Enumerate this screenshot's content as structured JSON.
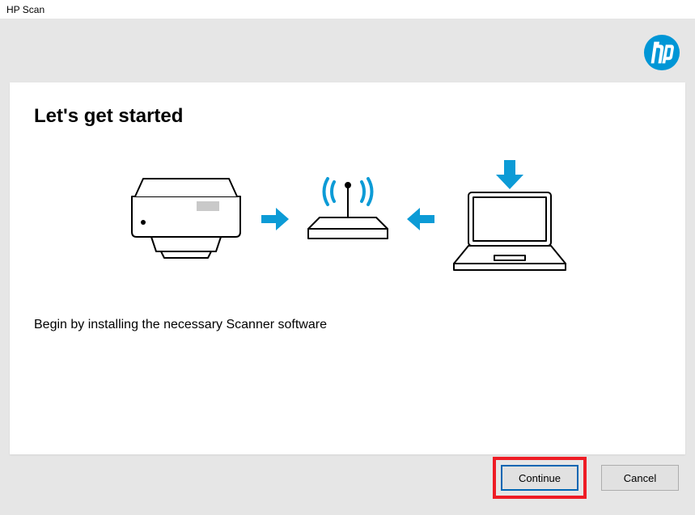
{
  "window": {
    "title": "HP Scan"
  },
  "brand": {
    "logo_label": "hp",
    "color": "#0096d6"
  },
  "card": {
    "heading": "Let's get started",
    "body": "Begin by installing the necessary Scanner software"
  },
  "illustration": {
    "printer_label": "printer",
    "router_label": "wifi-router",
    "laptop_label": "laptop",
    "arrow_color": "#0c9bd6"
  },
  "buttons": {
    "continue": "Continue",
    "cancel": "Cancel"
  }
}
